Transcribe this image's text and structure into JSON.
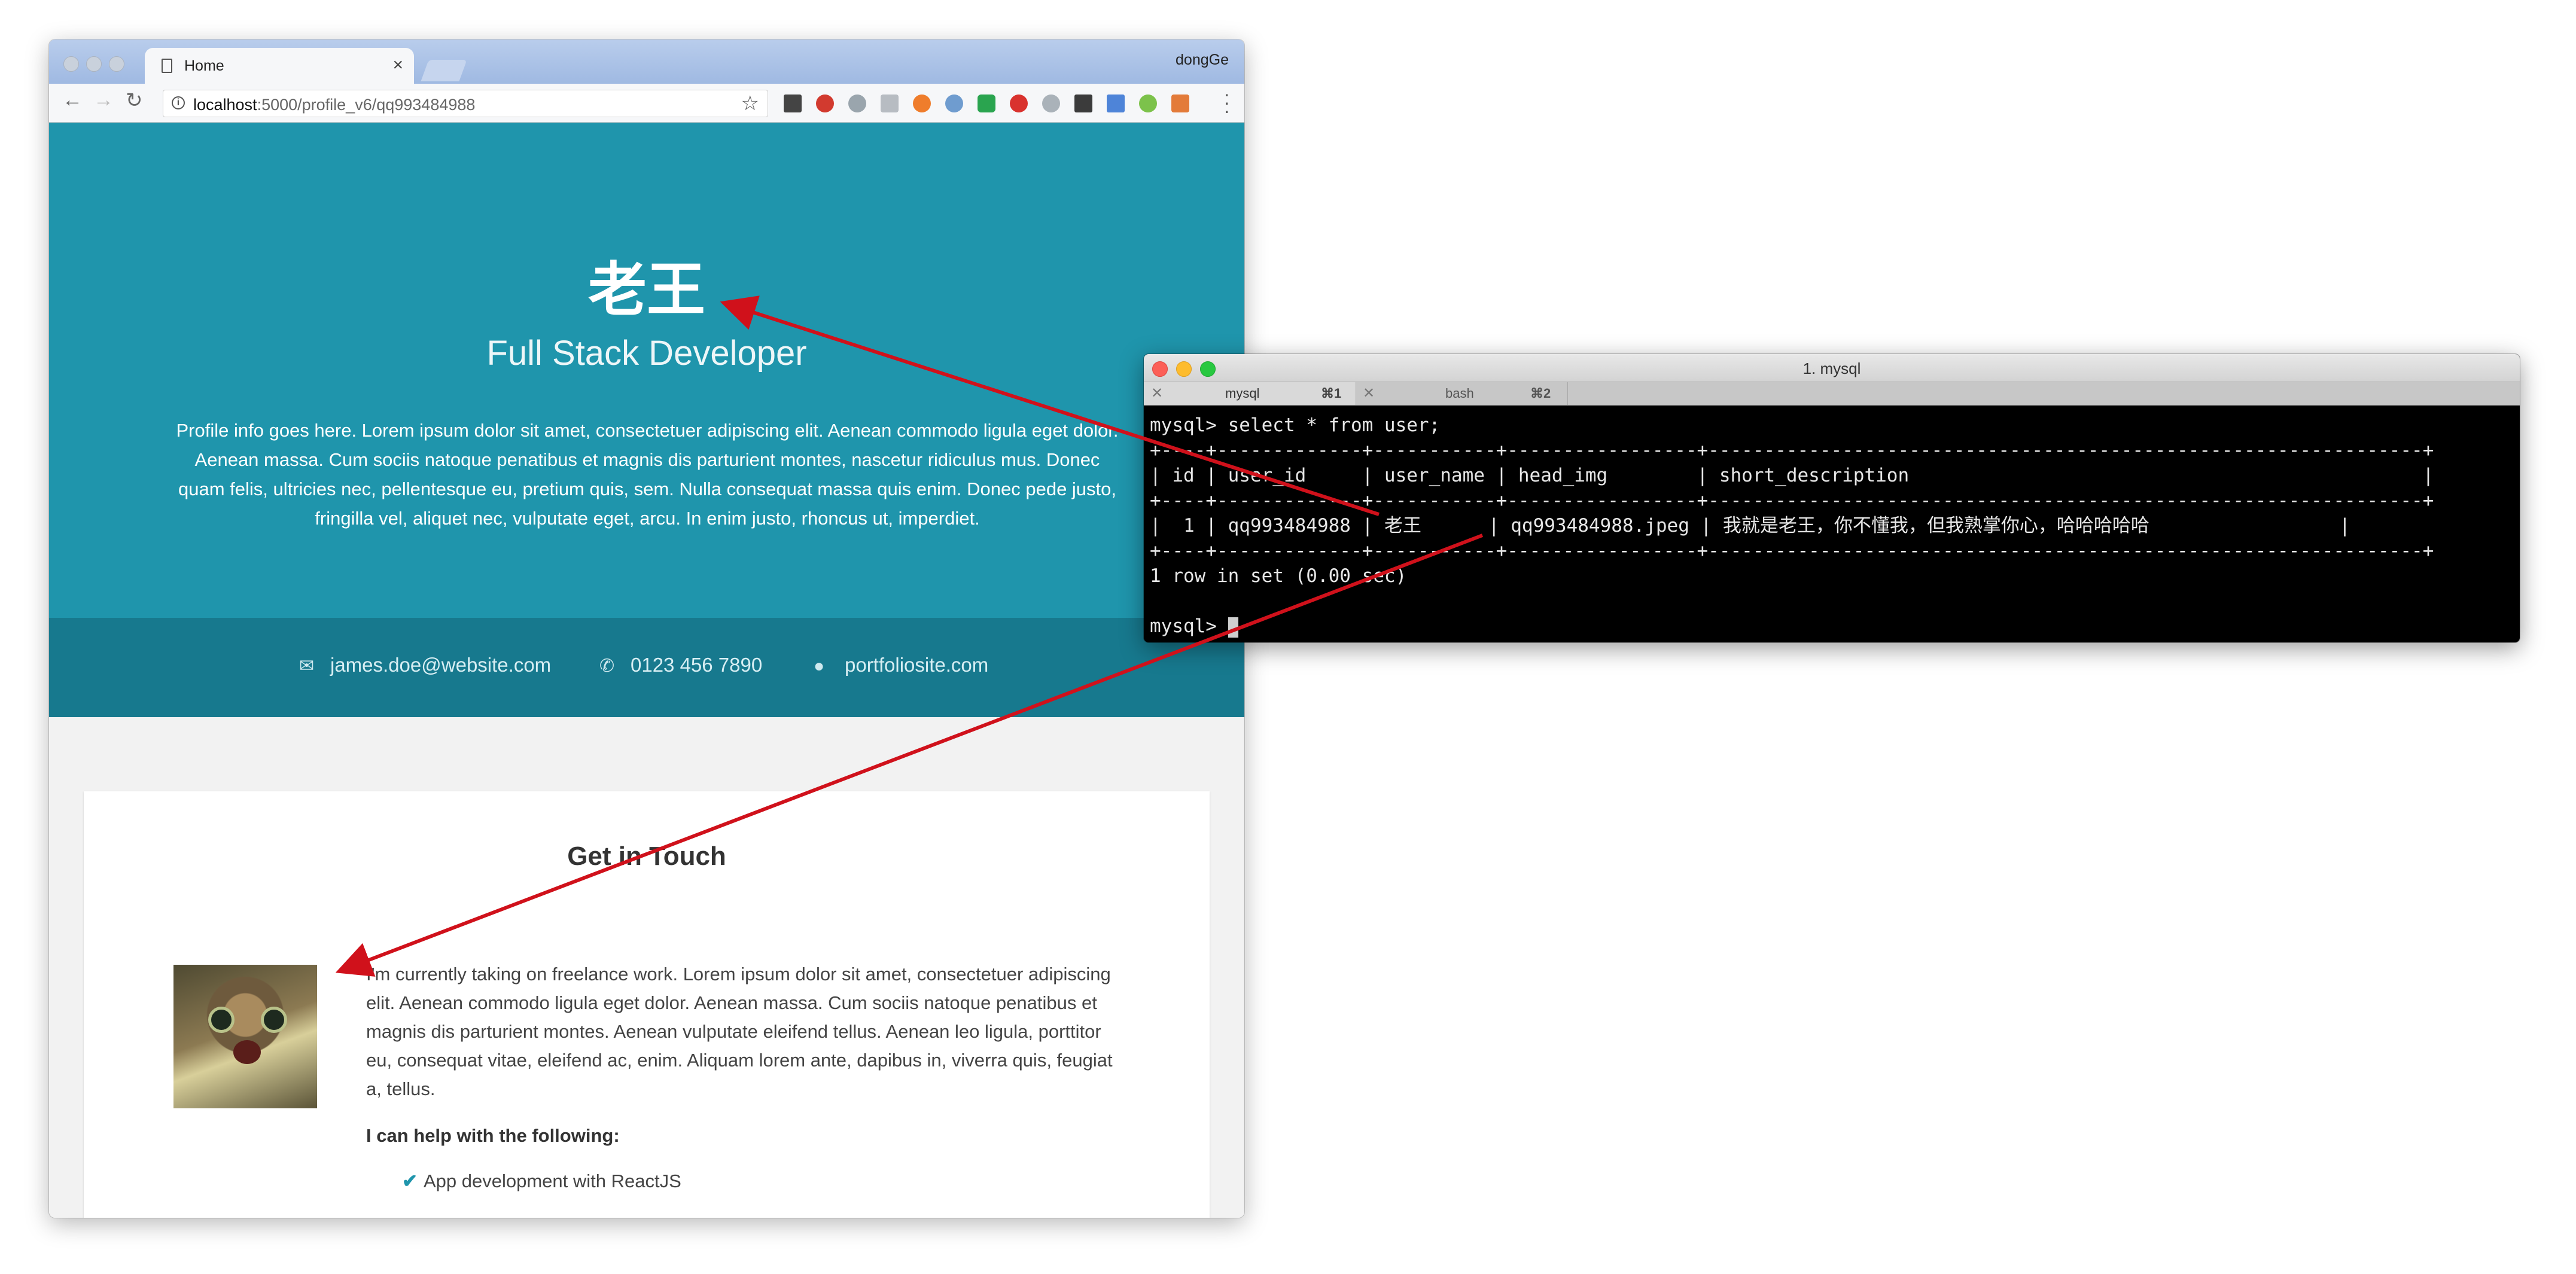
{
  "browser": {
    "tab_title": "Home",
    "tab_close": "×",
    "profile_name": "dongGe",
    "url_host": "localhost",
    "url_path": ":5000/profile_v6/qq993484988",
    "back": "←",
    "forward": "→",
    "reload": "↻",
    "star": "☆"
  },
  "page": {
    "name": "老王",
    "job_title": "Full Stack Developer",
    "intro": "Profile info goes here. Lorem ipsum dolor sit amet, consectetuer adipiscing elit. Aenean commodo ligula eget dolor. Aenean massa. Cum sociis natoque penatibus et magnis dis parturient montes, nascetur ridiculus mus. Donec quam felis, ultricies nec, pellentesque eu, pretium quis, sem. Nulla consequat massa quis enim. Donec pede justo, fringilla vel, aliquet nec, vulputate eget, arcu. In enim justo, rhoncus ut, imperdiet.",
    "contact": {
      "email": "james.doe@website.com",
      "phone": "0123 456 7890",
      "website": "portfoliosite.com"
    },
    "section_title": "Get in Touch",
    "description": "I'm currently taking on freelance work. Lorem ipsum dolor sit amet, consectetuer adipiscing elit. Aenean commodo ligula eget dolor. Aenean massa. Cum sociis natoque penatibus et magnis dis parturient montes. Aenean vulputate eleifend tellus. Aenean leo ligula, porttitor eu, consequat vitae, eleifend ac, enim. Aliquam lorem ante, dapibus in, viverra quis, feugiat a, tellus.",
    "help_heading": "I can help with the following:",
    "help_items": [
      "App development with ReactJS"
    ]
  },
  "terminal": {
    "window_title": "1. mysql",
    "tabs": [
      {
        "label": "mysql",
        "shortcut": "⌘1"
      },
      {
        "label": "bash",
        "shortcut": "⌘2"
      }
    ],
    "lines": [
      "mysql> select * from user;",
      "+----+-------------+-----------+-----------------+----------------------------------------------------------------+",
      "| id | user_id     | user_name | head_img        | short_description                                              |",
      "+----+-------------+-----------+-----------------+----------------------------------------------------------------+",
      "|  1 | qq993484988 | 老王      | qq993484988.jpeg | 我就是老王，你不懂我，但我熟掌你心，哈哈哈哈哈                 |",
      "+----+-------------+-----------+-----------------+----------------------------------------------------------------+",
      "1 row in set (0.00 sec)",
      "",
      "mysql> "
    ]
  },
  "colors": {
    "hero": "#1f95ac",
    "contact_bar": "#17798e",
    "arrow": "#d0111b"
  }
}
